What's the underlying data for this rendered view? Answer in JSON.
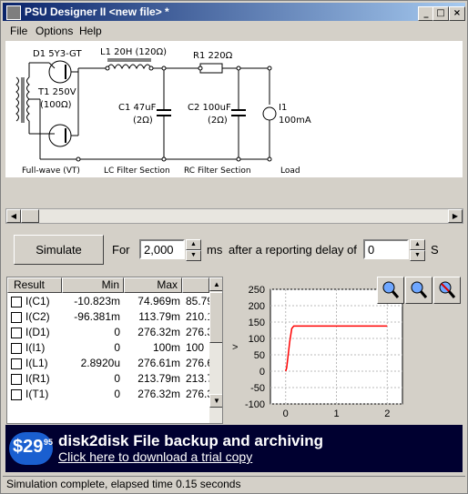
{
  "window": {
    "title": "PSU Designer II  <new file> *"
  },
  "window_buttons": {
    "minimize": "_",
    "maximize": "□",
    "close": "×"
  },
  "menu": [
    "File",
    "Options",
    "Help"
  ],
  "circuit": {
    "d1": "D1 5Y3-GT",
    "l1": "L1 20H (120Ω)",
    "r1": "R1 220Ω",
    "t1_a": "T1 250V",
    "t1_b": "(100Ω)",
    "c1_a": "C1 47uF",
    "c1_b": "(2Ω)",
    "c2_a": "C2 100uF",
    "c2_b": "(2Ω)",
    "i1_a": "I1",
    "i1_b": "100mA",
    "sec_fullwave": "Full-wave (VT)",
    "sec_lc": "LC Filter Section",
    "sec_rc": "RC Filter Section",
    "sec_load": "Load"
  },
  "sim": {
    "button": "Simulate",
    "for_label": "For",
    "duration": "2,000",
    "unit_ms": "ms",
    "delay_label": "after a reporting delay of",
    "delay": "0",
    "unit_s": "S"
  },
  "table": {
    "headers": [
      "Result",
      "Min",
      "Max",
      ""
    ],
    "rows": [
      {
        "name": "I(C1)",
        "min": "-10.823m",
        "max": "74.969m",
        "extra": "85.79"
      },
      {
        "name": "I(C2)",
        "min": "-96.381m",
        "max": "113.79m",
        "extra": "210.1"
      },
      {
        "name": "I(D1)",
        "min": "0",
        "max": "276.32m",
        "extra": "276.3"
      },
      {
        "name": "I(I1)",
        "min": "0",
        "max": "100m",
        "extra": "100"
      },
      {
        "name": "I(L1)",
        "min": "2.8920u",
        "max": "276.61m",
        "extra": "276.6"
      },
      {
        "name": "I(R1)",
        "min": "0",
        "max": "213.79m",
        "extra": "213.7"
      },
      {
        "name": "I(T1)",
        "min": "0",
        "max": "276.32m",
        "extra": "276.3"
      }
    ]
  },
  "chart_data": {
    "type": "line",
    "ylabel": ">",
    "xlim": [
      -0.3,
      2.3
    ],
    "ylim": [
      -100,
      250
    ],
    "yticks": [
      250,
      200,
      150,
      100,
      50,
      0,
      -50,
      -100
    ],
    "xticks": [
      0,
      1,
      2
    ],
    "grid": true,
    "series": [
      {
        "color": "#ff0000",
        "x": [
          0,
          0.02,
          0.08,
          0.12,
          0.16,
          1.5,
          2.0
        ],
        "y": [
          0,
          10,
          90,
          130,
          138,
          138,
          138
        ]
      }
    ]
  },
  "banner": {
    "price_main": "$29",
    "price_cents": "95",
    "title": "disk2disk File backup and archiving",
    "link": "Click here to download a trial copy"
  },
  "status": "Simulation complete, elapsed time 0.15 seconds",
  "colors": {
    "titlebar": "#0a246a",
    "trace": "#ff0000",
    "banner": "#000030"
  }
}
